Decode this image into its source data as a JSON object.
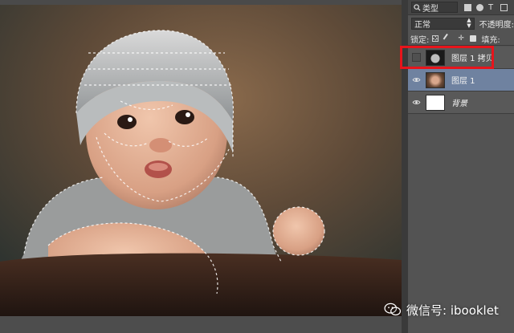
{
  "layers_panel": {
    "filter_kind": "类型",
    "blend_mode": "正常",
    "opacity_label": "不透明度:",
    "lock_label": "锁定:",
    "fill_label": "填充:",
    "layers": [
      {
        "name": "图层 1 拷贝",
        "visible": false,
        "selected": false,
        "italic": false
      },
      {
        "name": "图层 1",
        "visible": true,
        "selected": true,
        "italic": false
      },
      {
        "name": "背景",
        "visible": true,
        "selected": false,
        "italic": true
      }
    ]
  },
  "watermark": {
    "text": "微信号: ibooklet"
  },
  "icons": {
    "filter": "search-icon",
    "blend_dropdown": "chevron-updown-icon",
    "visibility": "eye-icon",
    "lock_pixels": "checkerboard-icon",
    "lock_paint": "brush-icon",
    "lock_move": "move-icon",
    "lock_all": "lock-icon",
    "wechat": "wechat-icon"
  },
  "colors": {
    "selection_highlight": "#e8141b",
    "selected_layer": "#6f82a0",
    "panel_bg": "#535353"
  }
}
